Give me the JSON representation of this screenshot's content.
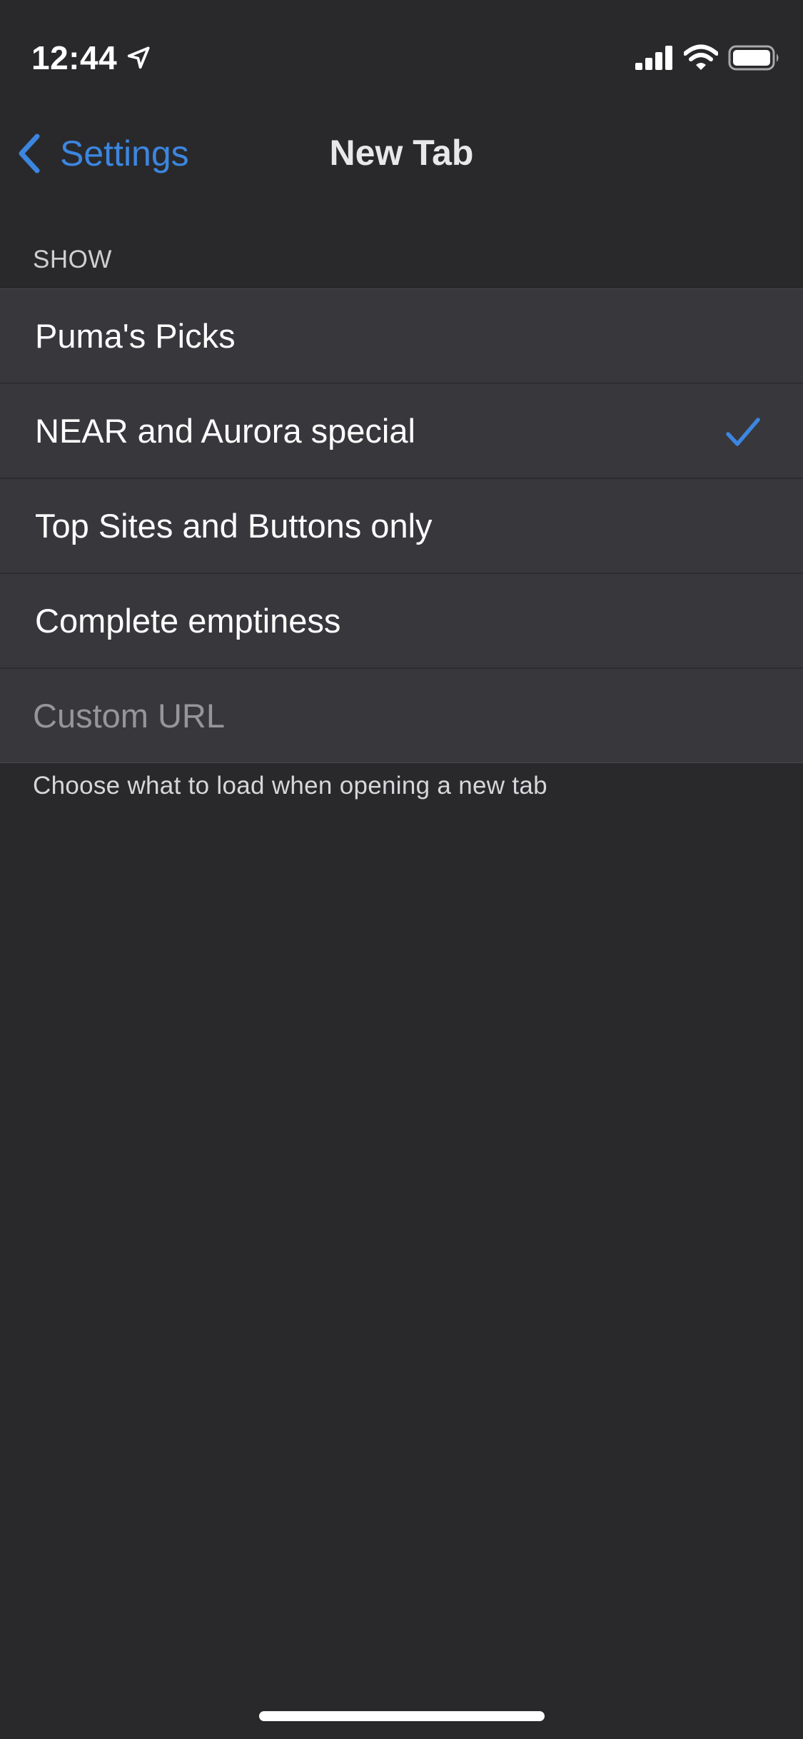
{
  "status_bar": {
    "time": "12:44",
    "location_icon": "location-arrow-icon",
    "signal_icon": "cellular-signal-icon",
    "wifi_icon": "wifi-icon",
    "battery_icon": "battery-icon"
  },
  "nav": {
    "back_label": "Settings",
    "back_icon": "chevron-left-icon",
    "title": "New Tab"
  },
  "section": {
    "header": "SHOW",
    "footer": "Choose what to load when opening a new tab",
    "options": [
      {
        "label": "Puma's Picks",
        "selected": false
      },
      {
        "label": "NEAR and Aurora special",
        "selected": true
      },
      {
        "label": "Top Sites and Buttons only",
        "selected": false
      },
      {
        "label": "Complete emptiness",
        "selected": false
      }
    ],
    "custom_url": {
      "value": "",
      "placeholder": "Custom URL"
    }
  },
  "colors": {
    "background": "#29292b",
    "cell_background": "#38373c",
    "accent": "#3c86e0",
    "placeholder": "#96959b"
  }
}
